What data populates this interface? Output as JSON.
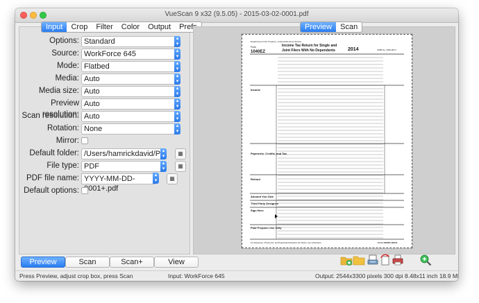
{
  "window": {
    "title": "VueScan 9 x32 (9.5.05) - 2015-03-02-0001.pdf"
  },
  "left_tabs": [
    "Input",
    "Crop",
    "Filter",
    "Color",
    "Output",
    "Prefs"
  ],
  "right_tabs": [
    "Preview",
    "Scan"
  ],
  "form": {
    "options": {
      "label": "Options:",
      "value": "Standard"
    },
    "source": {
      "label": "Source:",
      "value": "WorkForce 645"
    },
    "mode": {
      "label": "Mode:",
      "value": "Flatbed"
    },
    "media": {
      "label": "Media:",
      "value": "Auto"
    },
    "media_size": {
      "label": "Media size:",
      "value": "Auto"
    },
    "preview_resolution": {
      "label": "Preview resolution:",
      "value": "Auto"
    },
    "scan_resolution": {
      "label": "Scan resolution:",
      "value": "Auto"
    },
    "rotation": {
      "label": "Rotation:",
      "value": "None"
    },
    "mirror": {
      "label": "Mirror:"
    },
    "default_folder": {
      "label": "Default folder:",
      "value": "/Users/hamrickdavid/Pictures"
    },
    "file_type": {
      "label": "File type:",
      "value": "PDF"
    },
    "pdf_file_name": {
      "label": "PDF file name:",
      "value": "YYYY-MM-DD-0001+.pdf"
    },
    "default_options": {
      "label": "Default options:"
    }
  },
  "document": {
    "form_code": "Form",
    "form_id": "1040EZ",
    "year": "2014",
    "dept": "Department of the Treasury—Internal Revenue Service",
    "heading_line1": "Income Tax Return for Single and",
    "heading_line2": "Joint Filers With No Dependents",
    "omb": "OMB No. 1545-0074",
    "sections": [
      "Income",
      "Payments, Credits, and Tax",
      "Refund",
      "Amount You Owe",
      "Third Party Designee",
      "Sign Here",
      "Paid Preparer Use Only"
    ],
    "footer_left": "For Disclosure, Privacy Act, and Paperwork Reduction Act Notice, see instructions.",
    "footer_form": "Form 1040EZ (2014)"
  },
  "bottom_buttons": {
    "preview": "Preview",
    "scan": "Scan",
    "scan_plus": "Scan+",
    "view": "View"
  },
  "status": {
    "left": "Press Preview, adjust crop box, press Scan",
    "middle": "Input: WorkForce 645",
    "right": "Output: 2544x3300 pixels 300 dpi 8.48x11 inch 18.9 MB"
  },
  "colors": {
    "accent": "#2a7cf0",
    "close": "#fc605c",
    "minimize": "#fdbc40",
    "maximize": "#34c84a"
  },
  "icons": [
    "new-folder-icon",
    "folder-icon",
    "scanner-icon",
    "rotate-icon",
    "print-icon",
    "zoom-in-icon"
  ]
}
